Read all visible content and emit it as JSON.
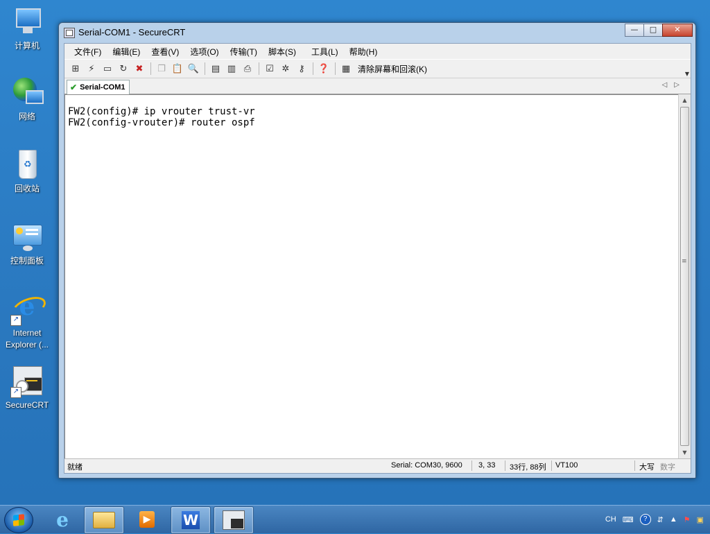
{
  "desktop": {
    "icons": [
      {
        "label": "计算机"
      },
      {
        "label": "网络"
      },
      {
        "label": "回收站"
      },
      {
        "label": "控制面板"
      },
      {
        "label": "Internet Explorer (..."
      },
      {
        "label": "SecureCRT"
      }
    ]
  },
  "window": {
    "title": "Serial-COM1 - SecureCRT",
    "controls": {
      "minimize": "—",
      "maximize": "□",
      "close": "✕"
    }
  },
  "menu": {
    "items": [
      "文件(F)",
      "编辑(E)",
      "查看(V)",
      "选项(O)",
      "传输(T)",
      "脚本(S)",
      "工具(L)",
      "帮助(H)"
    ]
  },
  "toolbar": {
    "clear_label": "清除屏幕和回滚(K)"
  },
  "tabs": {
    "active": "Serial-COM1"
  },
  "terminal": {
    "lines": [
      "FW2(config)# ip vrouter trust-vr",
      "FW2(config-vrouter)# router ospf"
    ]
  },
  "status": {
    "ready": "就绪",
    "connection": "Serial: COM30, 9600",
    "cursor": "3,  33",
    "size": "33行, 88列",
    "emulation": "VT100",
    "caps": "大写",
    "num": "数字"
  },
  "tray": {
    "lang": "CH"
  },
  "colors": {
    "desktop": "#2a78bf",
    "close_button": "#c7442e",
    "tab_check": "#2b9c2b"
  }
}
